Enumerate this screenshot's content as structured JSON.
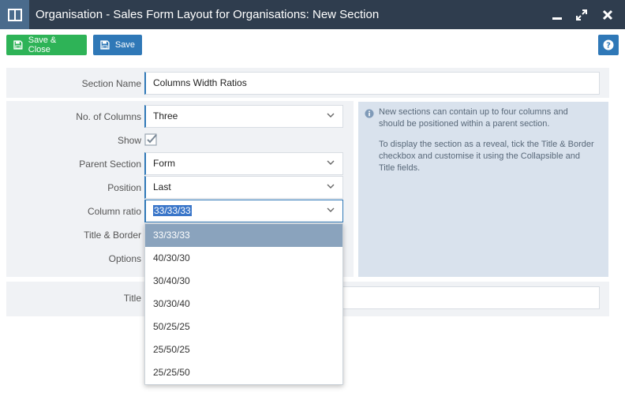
{
  "window": {
    "title": "Organisation - Sales Form Layout for Organisations: New Section"
  },
  "toolbar": {
    "save_close_label": "Save & Close",
    "save_label": "Save"
  },
  "form": {
    "section_name_label": "Section Name",
    "section_name_value": "Columns Width Ratios",
    "columns_label": "No. of Columns",
    "columns_value": "Three",
    "show_label": "Show",
    "parent_label": "Parent Section",
    "parent_value": "Form",
    "position_label": "Position",
    "position_value": "Last",
    "ratio_label": "Column ratio",
    "ratio_value": "33/33/33",
    "title_border_label": "Title & Border",
    "options_label": "Options",
    "title_label": "Title"
  },
  "info": {
    "line1": "New sections can contain up to four columns and should be positioned within a parent section.",
    "line2": "To display the section as a reveal, tick the Title & Border checkbox and customise it using the Collapsible and Title fields."
  },
  "ratio_options": [
    "33/33/33",
    "40/30/30",
    "30/40/30",
    "30/30/40",
    "50/25/25",
    "25/50/25",
    "25/25/50"
  ],
  "colors": {
    "titlebar": "#2f3d4e",
    "accent": "#2f78b7",
    "save_close": "#2eb357",
    "dropdown_selected": "#8aa3bd"
  }
}
